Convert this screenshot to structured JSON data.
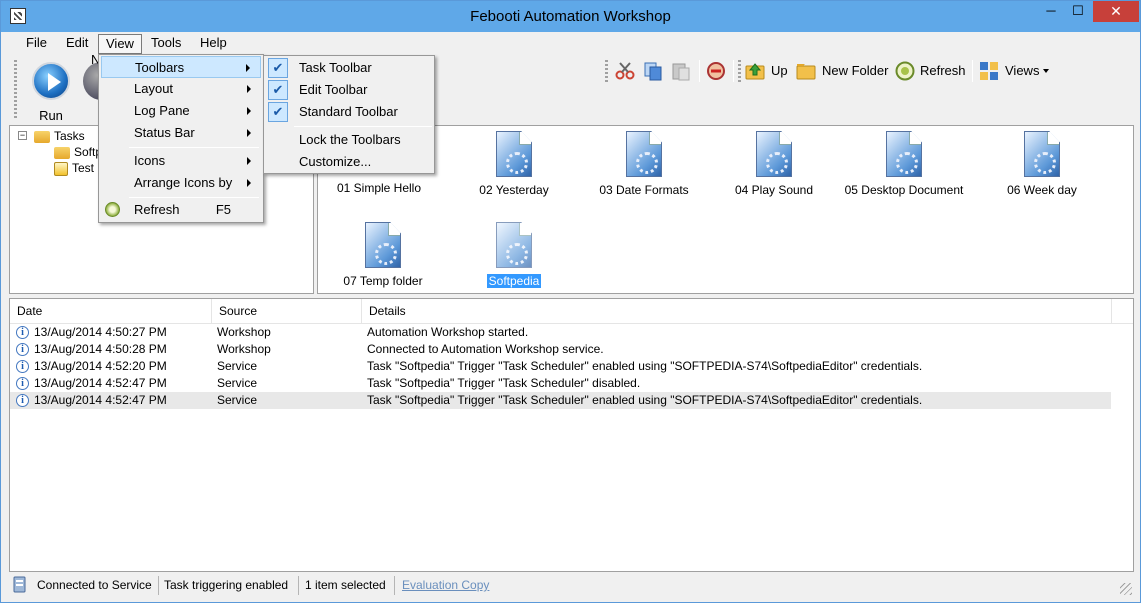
{
  "window": {
    "title": "Febooti Automation Workshop",
    "minimize": "─",
    "maximize": "☐",
    "close": "✕"
  },
  "menubar": [
    "File",
    "Edit",
    "View",
    "Tools",
    "Help"
  ],
  "toolbar_left": {
    "run": "Run",
    "new_partial": "N"
  },
  "toolbar_right": {
    "up": "Up",
    "new_folder": "New Folder",
    "refresh": "Refresh",
    "views": "Views"
  },
  "tree": {
    "root": "Tasks",
    "child1": "Softp",
    "child2": "Test"
  },
  "files": [
    {
      "label": "01 Simple Hello"
    },
    {
      "label": "02 Yesterday"
    },
    {
      "label": "03 Date Formats"
    },
    {
      "label": "04 Play Sound"
    },
    {
      "label": "05 Desktop Document"
    },
    {
      "label": "06 Week day"
    },
    {
      "label": "07 Temp folder"
    },
    {
      "label": "Softpedia"
    }
  ],
  "log": {
    "columns": [
      "Date",
      "Source",
      "Details"
    ],
    "rows": [
      {
        "date": "13/Aug/2014 4:50:27 PM",
        "source": "Workshop",
        "details": "Automation Workshop started."
      },
      {
        "date": "13/Aug/2014 4:50:28 PM",
        "source": "Workshop",
        "details": "Connected to Automation Workshop service."
      },
      {
        "date": "13/Aug/2014 4:52:20 PM",
        "source": "Service",
        "details": "Task \"Softpedia\" Trigger \"Task Scheduler\" enabled using \"SOFTPEDIA-S74\\SoftpediaEditor\" credentials."
      },
      {
        "date": "13/Aug/2014 4:52:47 PM",
        "source": "Service",
        "details": "Task \"Softpedia\" Trigger \"Task Scheduler\" disabled."
      },
      {
        "date": "13/Aug/2014 4:52:47 PM",
        "source": "Service",
        "details": "Task \"Softpedia\" Trigger \"Task Scheduler\" enabled using \"SOFTPEDIA-S74\\SoftpediaEditor\" credentials."
      }
    ]
  },
  "statusbar": {
    "connection": "Connected to Service",
    "triggering": "Task triggering enabled",
    "selection": "1 item selected",
    "evaluation": "Evaluation Copy"
  },
  "view_menu": {
    "toolbars": "Toolbars",
    "layout": "Layout",
    "log_pane": "Log Pane",
    "status_bar": "Status Bar",
    "icons": "Icons",
    "arrange": "Arrange Icons by",
    "refresh": "Refresh",
    "refresh_accel": "F5"
  },
  "toolbars_submenu": {
    "task": "Task Toolbar",
    "edit": "Edit Toolbar",
    "standard": "Standard Toolbar",
    "lock": "Lock the Toolbars",
    "customize": "Customize...",
    "checkmark": "✔"
  },
  "icons": {
    "cut": "scissors-icon",
    "copy": "copy-icon",
    "paste": "paste-icon",
    "delete": "delete-icon",
    "up": "folder-up-icon",
    "new_folder": "new-folder-icon",
    "refresh": "refresh-icon",
    "views": "views-icon",
    "info": "i"
  },
  "colors": {
    "titlebar": "#5fa8e8",
    "close": "#c7403a",
    "menu_highlight": "#cde8ff",
    "selection": "#3399ff",
    "link": "#6a8fbd"
  }
}
